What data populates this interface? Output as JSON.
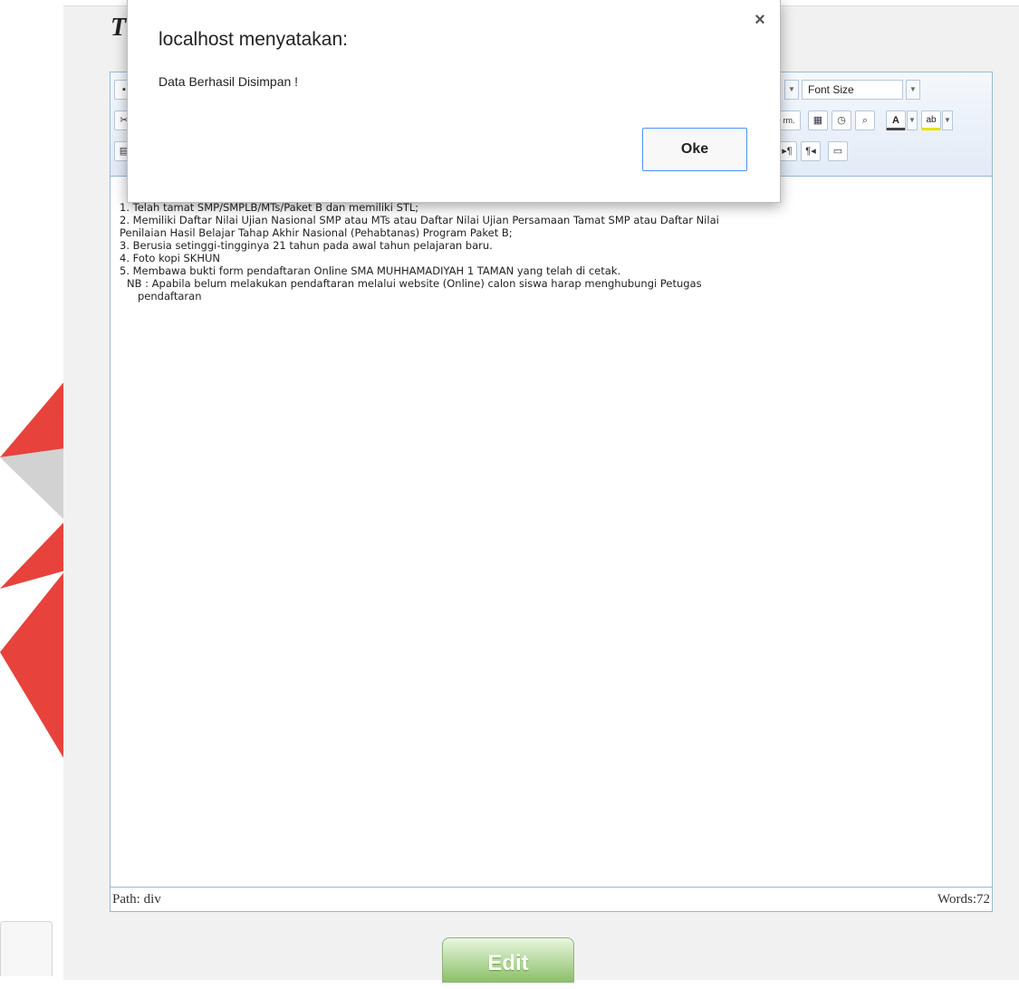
{
  "page": {
    "title_visible_fragment": "T"
  },
  "toolbar": {
    "font_size_label": "Font Size"
  },
  "editor": {
    "lines": [
      "1. Telah tamat SMP/SMPLB/MTs/Paket B dan memiliki STL;",
      "2. Memiliki Daftar Nilai Ujian Nasional SMP atau MTs atau Daftar Nilai Ujian Persamaan Tamat SMP atau Daftar Nilai",
      "Penilaian Hasil Belajar Tahap Akhir Nasional (Pehabtanas) Program Paket B;",
      "3. Berusia setinggi-tingginya 21 tahun pada awal tahun pelajaran baru.",
      "4. Foto kopi SKHUN",
      "5. Membawa bukti form pendaftaran Online SMA MUHHAMADIYAH 1 TAMAN yang telah di cetak.",
      "NB : Apabila belum melakukan pendaftaran melalui website (Online) calon siswa harap menghubungi Petugas",
      "pendaftaran"
    ],
    "status_path": "Path: div",
    "status_words": "Words:72"
  },
  "actions": {
    "edit_label": "Edit"
  },
  "dialog": {
    "title": "localhost menyatakan:",
    "message": "Data Berhasil Disimpan  !",
    "ok_label": "Oke",
    "close_glyph": "×"
  },
  "colors": {
    "logo_red": "#e8423c",
    "logo_gray": "#c9c9c9",
    "editor_border": "#9ab7d6",
    "edit_green": "#8cc068",
    "ok_border": "#4d90fe"
  }
}
